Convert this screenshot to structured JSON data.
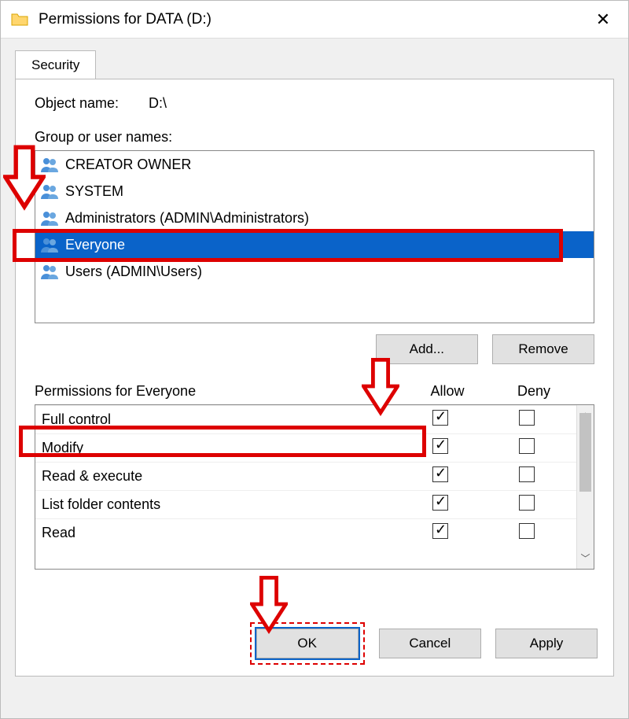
{
  "window": {
    "title": "Permissions for DATA (D:)"
  },
  "tab": {
    "security": "Security"
  },
  "objectName": {
    "label": "Object name:",
    "value": "D:\\"
  },
  "groupsLabel": "Group or user names:",
  "groups": [
    {
      "name": "CREATOR OWNER",
      "selected": false
    },
    {
      "name": "SYSTEM",
      "selected": false
    },
    {
      "name": "Administrators (ADMIN\\Administrators)",
      "selected": false
    },
    {
      "name": "Everyone",
      "selected": true
    },
    {
      "name": "Users (ADMIN\\Users)",
      "selected": false
    }
  ],
  "buttons": {
    "add": "Add...",
    "remove": "Remove",
    "ok": "OK",
    "cancel": "Cancel",
    "apply": "Apply"
  },
  "permHeader": {
    "title": "Permissions for Everyone",
    "allow": "Allow",
    "deny": "Deny"
  },
  "permissions": [
    {
      "name": "Full control",
      "allow": true,
      "deny": false
    },
    {
      "name": "Modify",
      "allow": true,
      "deny": false
    },
    {
      "name": "Read & execute",
      "allow": true,
      "deny": false
    },
    {
      "name": "List folder contents",
      "allow": true,
      "deny": false
    },
    {
      "name": "Read",
      "allow": true,
      "deny": false
    }
  ]
}
